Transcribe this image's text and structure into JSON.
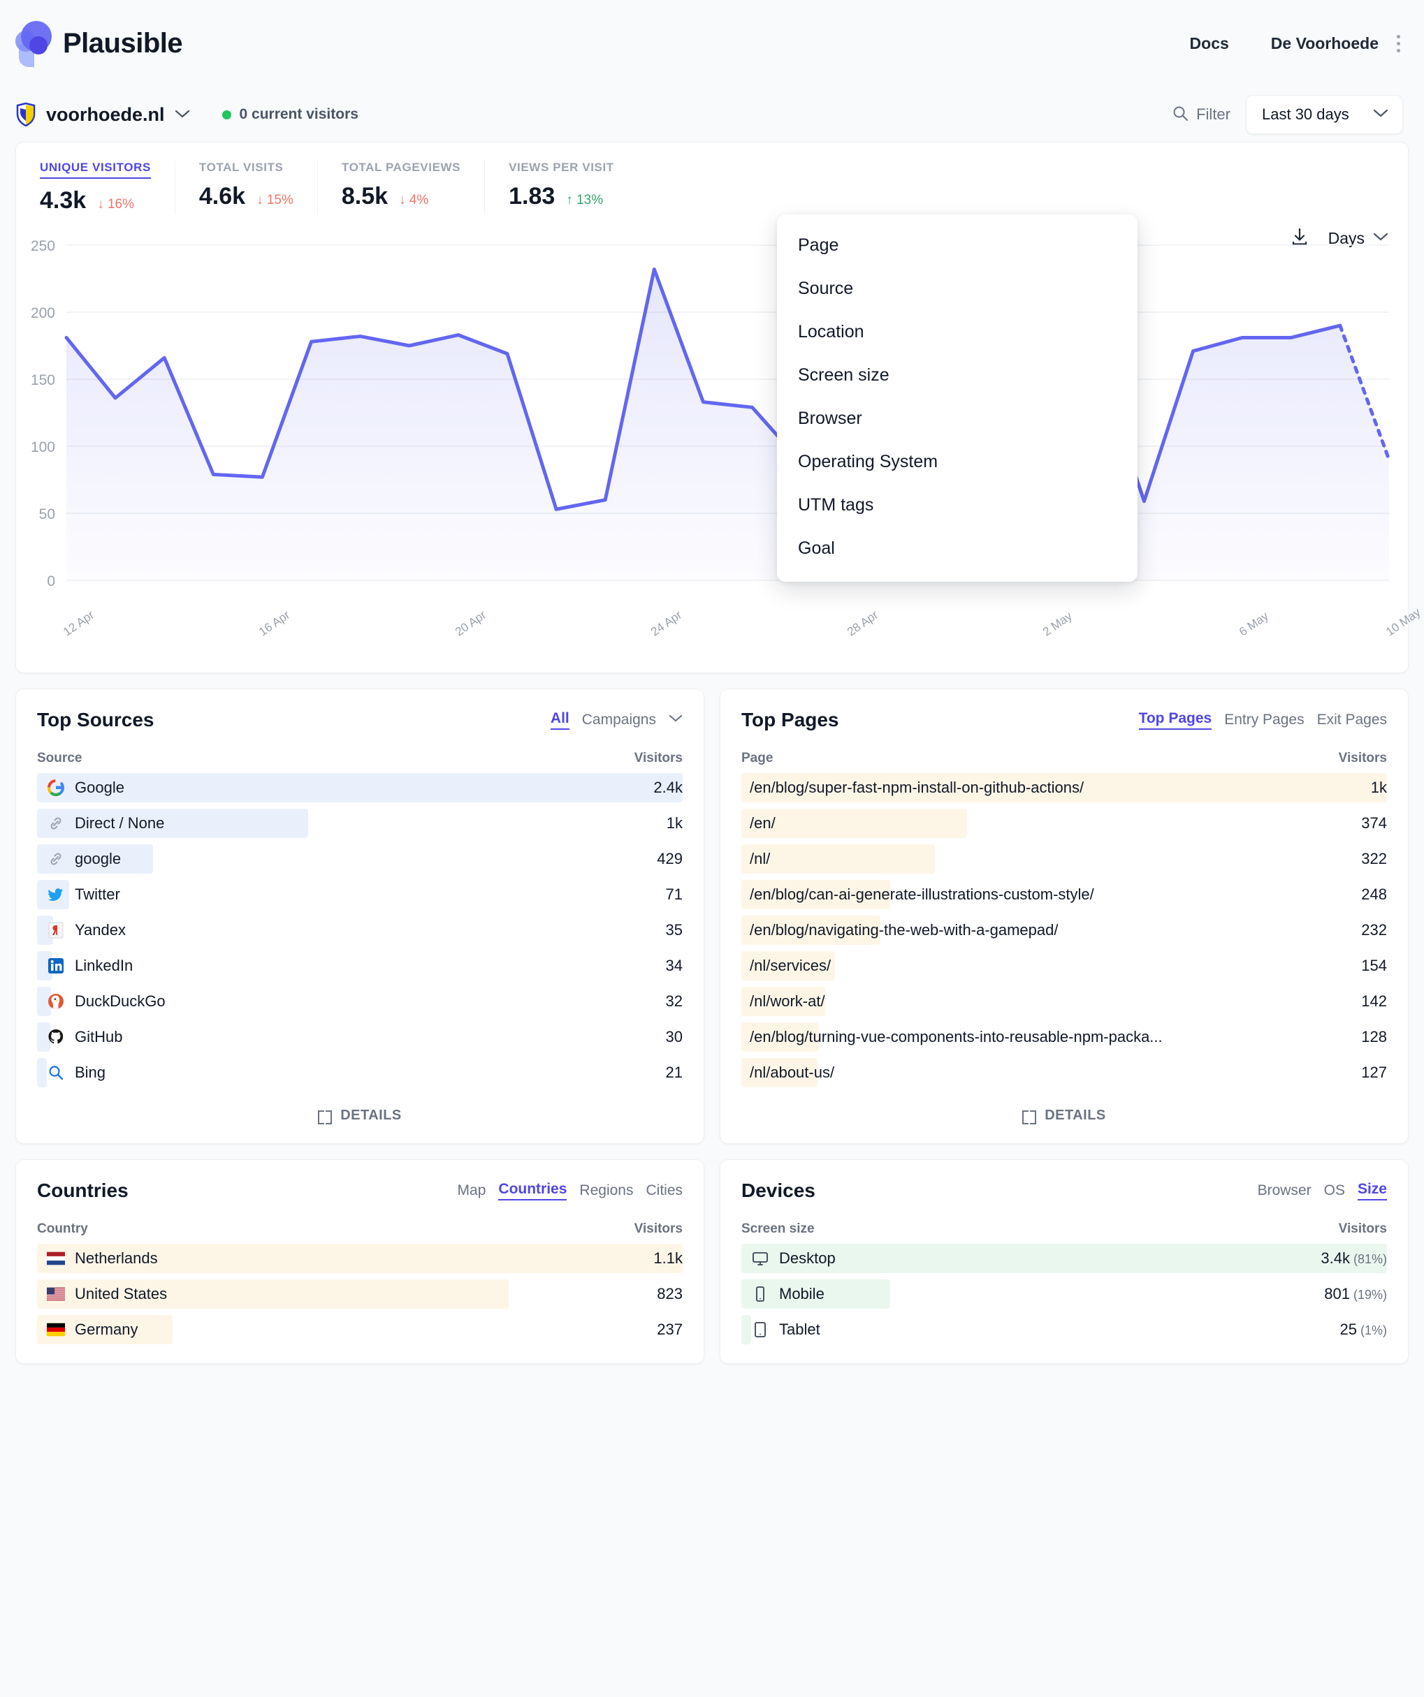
{
  "header": {
    "brand": "Plausible",
    "docs_label": "Docs",
    "user_label": "De Voorhoede",
    "kebab_icon": "kebab-menu-icon"
  },
  "sitebar": {
    "site_name": "voorhoede.nl",
    "site_chevron": "chevron-down-icon",
    "current_visitors": "0 current visitors",
    "filter_label": "Filter",
    "filter_icon": "search-icon",
    "date_range": "Last 30 days",
    "range_chevron": "chevron-down-icon"
  },
  "filter_menu": {
    "items": [
      "Page",
      "Source",
      "Location",
      "Screen size",
      "Browser",
      "Operating System",
      "UTM tags",
      "Goal"
    ]
  },
  "metrics": [
    {
      "label": "UNIQUE VISITORS",
      "value": "4.3k",
      "change": "16%",
      "direction": "down",
      "active": true
    },
    {
      "label": "TOTAL VISITS",
      "value": "4.6k",
      "change": "15%",
      "direction": "down",
      "active": false
    },
    {
      "label": "TOTAL PAGEVIEWS",
      "value": "8.5k",
      "change": "4%",
      "direction": "down",
      "active": false
    },
    {
      "label": "VIEWS PER VISIT",
      "value": "1.83",
      "change": "13%",
      "direction": "up",
      "active": false
    }
  ],
  "chart_toolbar": {
    "download_icon": "download-icon",
    "interval_label": "Days",
    "interval_chevron": "chevron-down-icon"
  },
  "chart_data": {
    "type": "line",
    "title": "Unique visitors",
    "xlabel": "",
    "ylabel": "",
    "ylim": [
      0,
      250
    ],
    "yticks": [
      0,
      50,
      100,
      150,
      200,
      250
    ],
    "grid": true,
    "legend": false,
    "accent": "#6366f1",
    "fill": "#eef0fb",
    "tick_labels": [
      "12 Apr",
      "16 Apr",
      "20 Apr",
      "24 Apr",
      "28 Apr",
      "2 May",
      "6 May",
      "10 May"
    ],
    "tick_indices": [
      0,
      4,
      8,
      12,
      16,
      20,
      24,
      28
    ],
    "x": [
      "12 Apr",
      "13 Apr",
      "14 Apr",
      "15 Apr",
      "16 Apr",
      "17 Apr",
      "18 Apr",
      "19 Apr",
      "20 Apr",
      "21 Apr",
      "22 Apr",
      "23 Apr",
      "24 Apr",
      "25 Apr",
      "26 Apr",
      "27 Apr",
      "28 Apr",
      "29 Apr",
      "30 Apr",
      "1 May",
      "2 May",
      "3 May",
      "4 May",
      "5 May",
      "6 May",
      "7 May",
      "8 May",
      "9 May",
      "10 May",
      "11 May"
    ],
    "values": [
      181,
      136,
      166,
      79,
      77,
      178,
      182,
      175,
      183,
      169,
      53,
      60,
      232,
      133,
      129,
      88,
      76,
      118,
      181,
      175,
      183,
      169,
      59,
      171,
      181,
      181,
      190,
      90
    ],
    "series": [
      {
        "name": "Unique visitors",
        "values": [
          181,
          136,
          166,
          79,
          77,
          178,
          182,
          175,
          183,
          169,
          53,
          60,
          232,
          133,
          129,
          88,
          76,
          118,
          181,
          175,
          183,
          169,
          59,
          171,
          181,
          181,
          190,
          90
        ],
        "dashed_tail": true
      }
    ]
  },
  "top_sources": {
    "title": "Top Sources",
    "tabs": [
      {
        "label": "All",
        "active": true
      },
      {
        "label": "Campaigns",
        "active": false
      }
    ],
    "tabs_chevron": "chevron-down-icon",
    "col_left": "Source",
    "col_right": "Visitors",
    "bar_color": "#eaf0fb",
    "rows": [
      {
        "name": "Google",
        "value": "2.4k",
        "pct": 100,
        "icon": "google-icon"
      },
      {
        "name": "Direct / None",
        "value": "1k",
        "pct": 42,
        "icon": "link-icon"
      },
      {
        "name": "google",
        "value": "429",
        "pct": 18,
        "icon": "link-icon"
      },
      {
        "name": "Twitter",
        "value": "71",
        "pct": 5,
        "icon": "twitter-icon"
      },
      {
        "name": "Yandex",
        "value": "35",
        "pct": 2.5,
        "icon": "yandex-icon"
      },
      {
        "name": "LinkedIn",
        "value": "34",
        "pct": 2.4,
        "icon": "linkedin-icon"
      },
      {
        "name": "DuckDuckGo",
        "value": "32",
        "pct": 2.2,
        "icon": "duckduckgo-icon"
      },
      {
        "name": "GitHub",
        "value": "30",
        "pct": 2.1,
        "icon": "github-icon"
      },
      {
        "name": "Bing",
        "value": "21",
        "pct": 1.5,
        "icon": "bing-icon"
      }
    ],
    "details_label": "DETAILS"
  },
  "top_pages": {
    "title": "Top Pages",
    "tabs": [
      {
        "label": "Top Pages",
        "active": true
      },
      {
        "label": "Entry Pages",
        "active": false
      },
      {
        "label": "Exit Pages",
        "active": false
      }
    ],
    "col_left": "Page",
    "col_right": "Visitors",
    "bar_color": "#fdf6e7",
    "rows": [
      {
        "name": "/en/blog/super-fast-npm-install-on-github-actions/",
        "value": "1k",
        "pct": 100
      },
      {
        "name": "/en/",
        "value": "374",
        "pct": 35
      },
      {
        "name": "/nl/",
        "value": "322",
        "pct": 30
      },
      {
        "name": "/en/blog/can-ai-generate-illustrations-custom-style/",
        "value": "248",
        "pct": 23
      },
      {
        "name": "/en/blog/navigating-the-web-with-a-gamepad/",
        "value": "232",
        "pct": 21.5
      },
      {
        "name": "/nl/services/",
        "value": "154",
        "pct": 14.5
      },
      {
        "name": "/nl/work-at/",
        "value": "142",
        "pct": 13
      },
      {
        "name": "/en/blog/turning-vue-components-into-reusable-npm-packa...",
        "value": "128",
        "pct": 12
      },
      {
        "name": "/nl/about-us/",
        "value": "127",
        "pct": 11.8
      }
    ],
    "details_label": "DETAILS"
  },
  "countries": {
    "title": "Countries",
    "tabs": [
      {
        "label": "Map",
        "active": false
      },
      {
        "label": "Countries",
        "active": true
      },
      {
        "label": "Regions",
        "active": false
      },
      {
        "label": "Cities",
        "active": false
      }
    ],
    "col_left": "Country",
    "col_right": "Visitors",
    "bar_color": "#fdf6e7",
    "rows": [
      {
        "name": "Netherlands",
        "value": "1.1k",
        "pct": 100,
        "flag": "netherlands-flag"
      },
      {
        "name": "United States",
        "value": "823",
        "pct": 73,
        "flag": "united-states-flag"
      },
      {
        "name": "Germany",
        "value": "237",
        "pct": 21,
        "flag": "germany-flag"
      }
    ]
  },
  "devices": {
    "title": "Devices",
    "tabs": [
      {
        "label": "Browser",
        "active": false
      },
      {
        "label": "OS",
        "active": false
      },
      {
        "label": "Size",
        "active": true
      }
    ],
    "col_left": "Screen size",
    "col_right": "Visitors",
    "bar_color": "#eaf7ee",
    "rows": [
      {
        "name": "Desktop",
        "value": "3.4k",
        "pct_label": "(81%)",
        "pct": 100,
        "icon": "desktop-icon"
      },
      {
        "name": "Mobile",
        "value": "801",
        "pct_label": "(19%)",
        "pct": 23,
        "icon": "mobile-icon"
      },
      {
        "name": "Tablet",
        "value": "25",
        "pct_label": "(1%)",
        "pct": 1.5,
        "icon": "tablet-icon"
      }
    ]
  }
}
